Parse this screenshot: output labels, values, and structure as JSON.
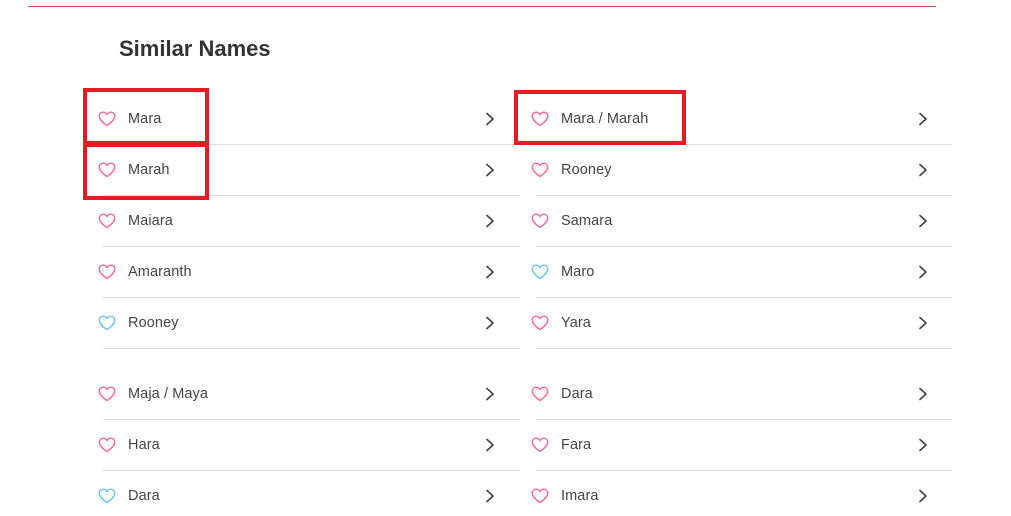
{
  "section": {
    "title": "Similar Names"
  },
  "colors": {
    "pink_heart": "#f06b9c",
    "blue_heart": "#6fc3e6",
    "highlight_box": "#e31b23",
    "divider": "#d04a55"
  },
  "names_left_group_a": [
    {
      "label": "Mara",
      "heart": "pink"
    },
    {
      "label": "Marah",
      "heart": "pink"
    },
    {
      "label": "Maiara",
      "heart": "pink"
    },
    {
      "label": "Amaranth",
      "heart": "pink"
    },
    {
      "label": "Rooney",
      "heart": "blue"
    }
  ],
  "names_right_group_a": [
    {
      "label": "Mara / Marah",
      "heart": "pink"
    },
    {
      "label": "Rooney",
      "heart": "pink"
    },
    {
      "label": "Samara",
      "heart": "pink"
    },
    {
      "label": "Maro",
      "heart": "blue"
    },
    {
      "label": "Yara",
      "heart": "pink"
    }
  ],
  "names_left_group_b": [
    {
      "label": "Maja / Maya",
      "heart": "pink"
    },
    {
      "label": "Hara",
      "heart": "pink"
    },
    {
      "label": "Dara",
      "heart": "blue"
    }
  ],
  "names_right_group_b": [
    {
      "label": "Dara",
      "heart": "pink"
    },
    {
      "label": "Fara",
      "heart": "pink"
    },
    {
      "label": "Imara",
      "heart": "pink"
    }
  ]
}
